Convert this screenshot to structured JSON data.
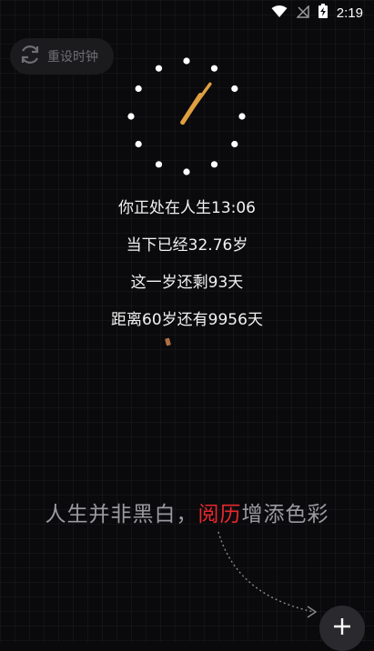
{
  "status_bar": {
    "time": "2:19",
    "icons": [
      "wifi-icon",
      "no-signal-icon",
      "battery-charging-icon"
    ]
  },
  "reset_button": {
    "label": "重设时钟",
    "icon": "refresh-icon"
  },
  "clock": {
    "hour": 1,
    "minute": 6
  },
  "stats": {
    "line1": "你正处在人生13:06",
    "line2": "当下已经32.76岁",
    "line3": "这一岁还剩93天",
    "line4": "距离60岁还有9956天"
  },
  "slogan": {
    "part1": "人生并非黑白，",
    "highlight": "阅历",
    "part2": "增添色彩"
  },
  "add_button": {
    "icon": "plus-icon"
  },
  "colors": {
    "background": "#0a0a0c",
    "accent": "#e8282e",
    "hand": "#e0a040",
    "button_bg": "#1b1b1e"
  }
}
